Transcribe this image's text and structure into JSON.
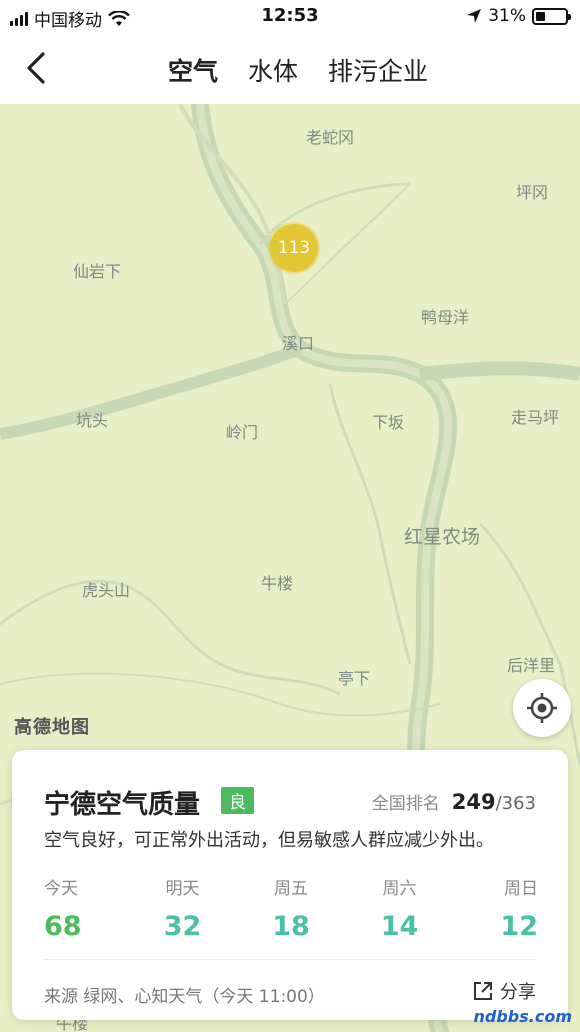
{
  "status_bar": {
    "carrier": "中国移动",
    "time": "12:53",
    "battery": "31%",
    "battery_level": 0.31
  },
  "nav": {
    "tabs": [
      "空气",
      "水体",
      "排污企业"
    ],
    "active_tab": "空气"
  },
  "map": {
    "logo": "高德地图",
    "cluster_value": "113",
    "places": [
      "老蛇冈",
      "坪冈",
      "仙岩下",
      "鸭母洋",
      "溪口",
      "坑头",
      "岭门",
      "下坂",
      "走马坪",
      "红星农场",
      "虎头山",
      "牛楼",
      "后洋里",
      "亭下",
      "牛楼"
    ]
  },
  "card": {
    "title": "宁德空气质量",
    "badge": "良",
    "rank_label": "全国排名",
    "rank_value": "249",
    "rank_total": "/363",
    "description": "空气良好，可正常外出活动，但易敏感人群应减少外出。",
    "forecast": [
      {
        "label": "今天",
        "value": "68",
        "color": "#4cbb5e"
      },
      {
        "label": "明天",
        "value": "32",
        "color": "#4cbfa8"
      },
      {
        "label": "周五",
        "value": "18",
        "color": "#4cbfa8"
      },
      {
        "label": "周六",
        "value": "14",
        "color": "#4cbfa8"
      },
      {
        "label": "周日",
        "value": "12",
        "color": "#4cbfa8"
      }
    ],
    "source": "来源 绿网、心知天气（今天 11:00）",
    "share_label": "分享"
  },
  "watermark": "ndbbs.com",
  "colors": {
    "map_bg": "#e8eec6",
    "river": "#c8d9b6",
    "cluster": "#e3c634",
    "badge": "#4cbb5e"
  }
}
